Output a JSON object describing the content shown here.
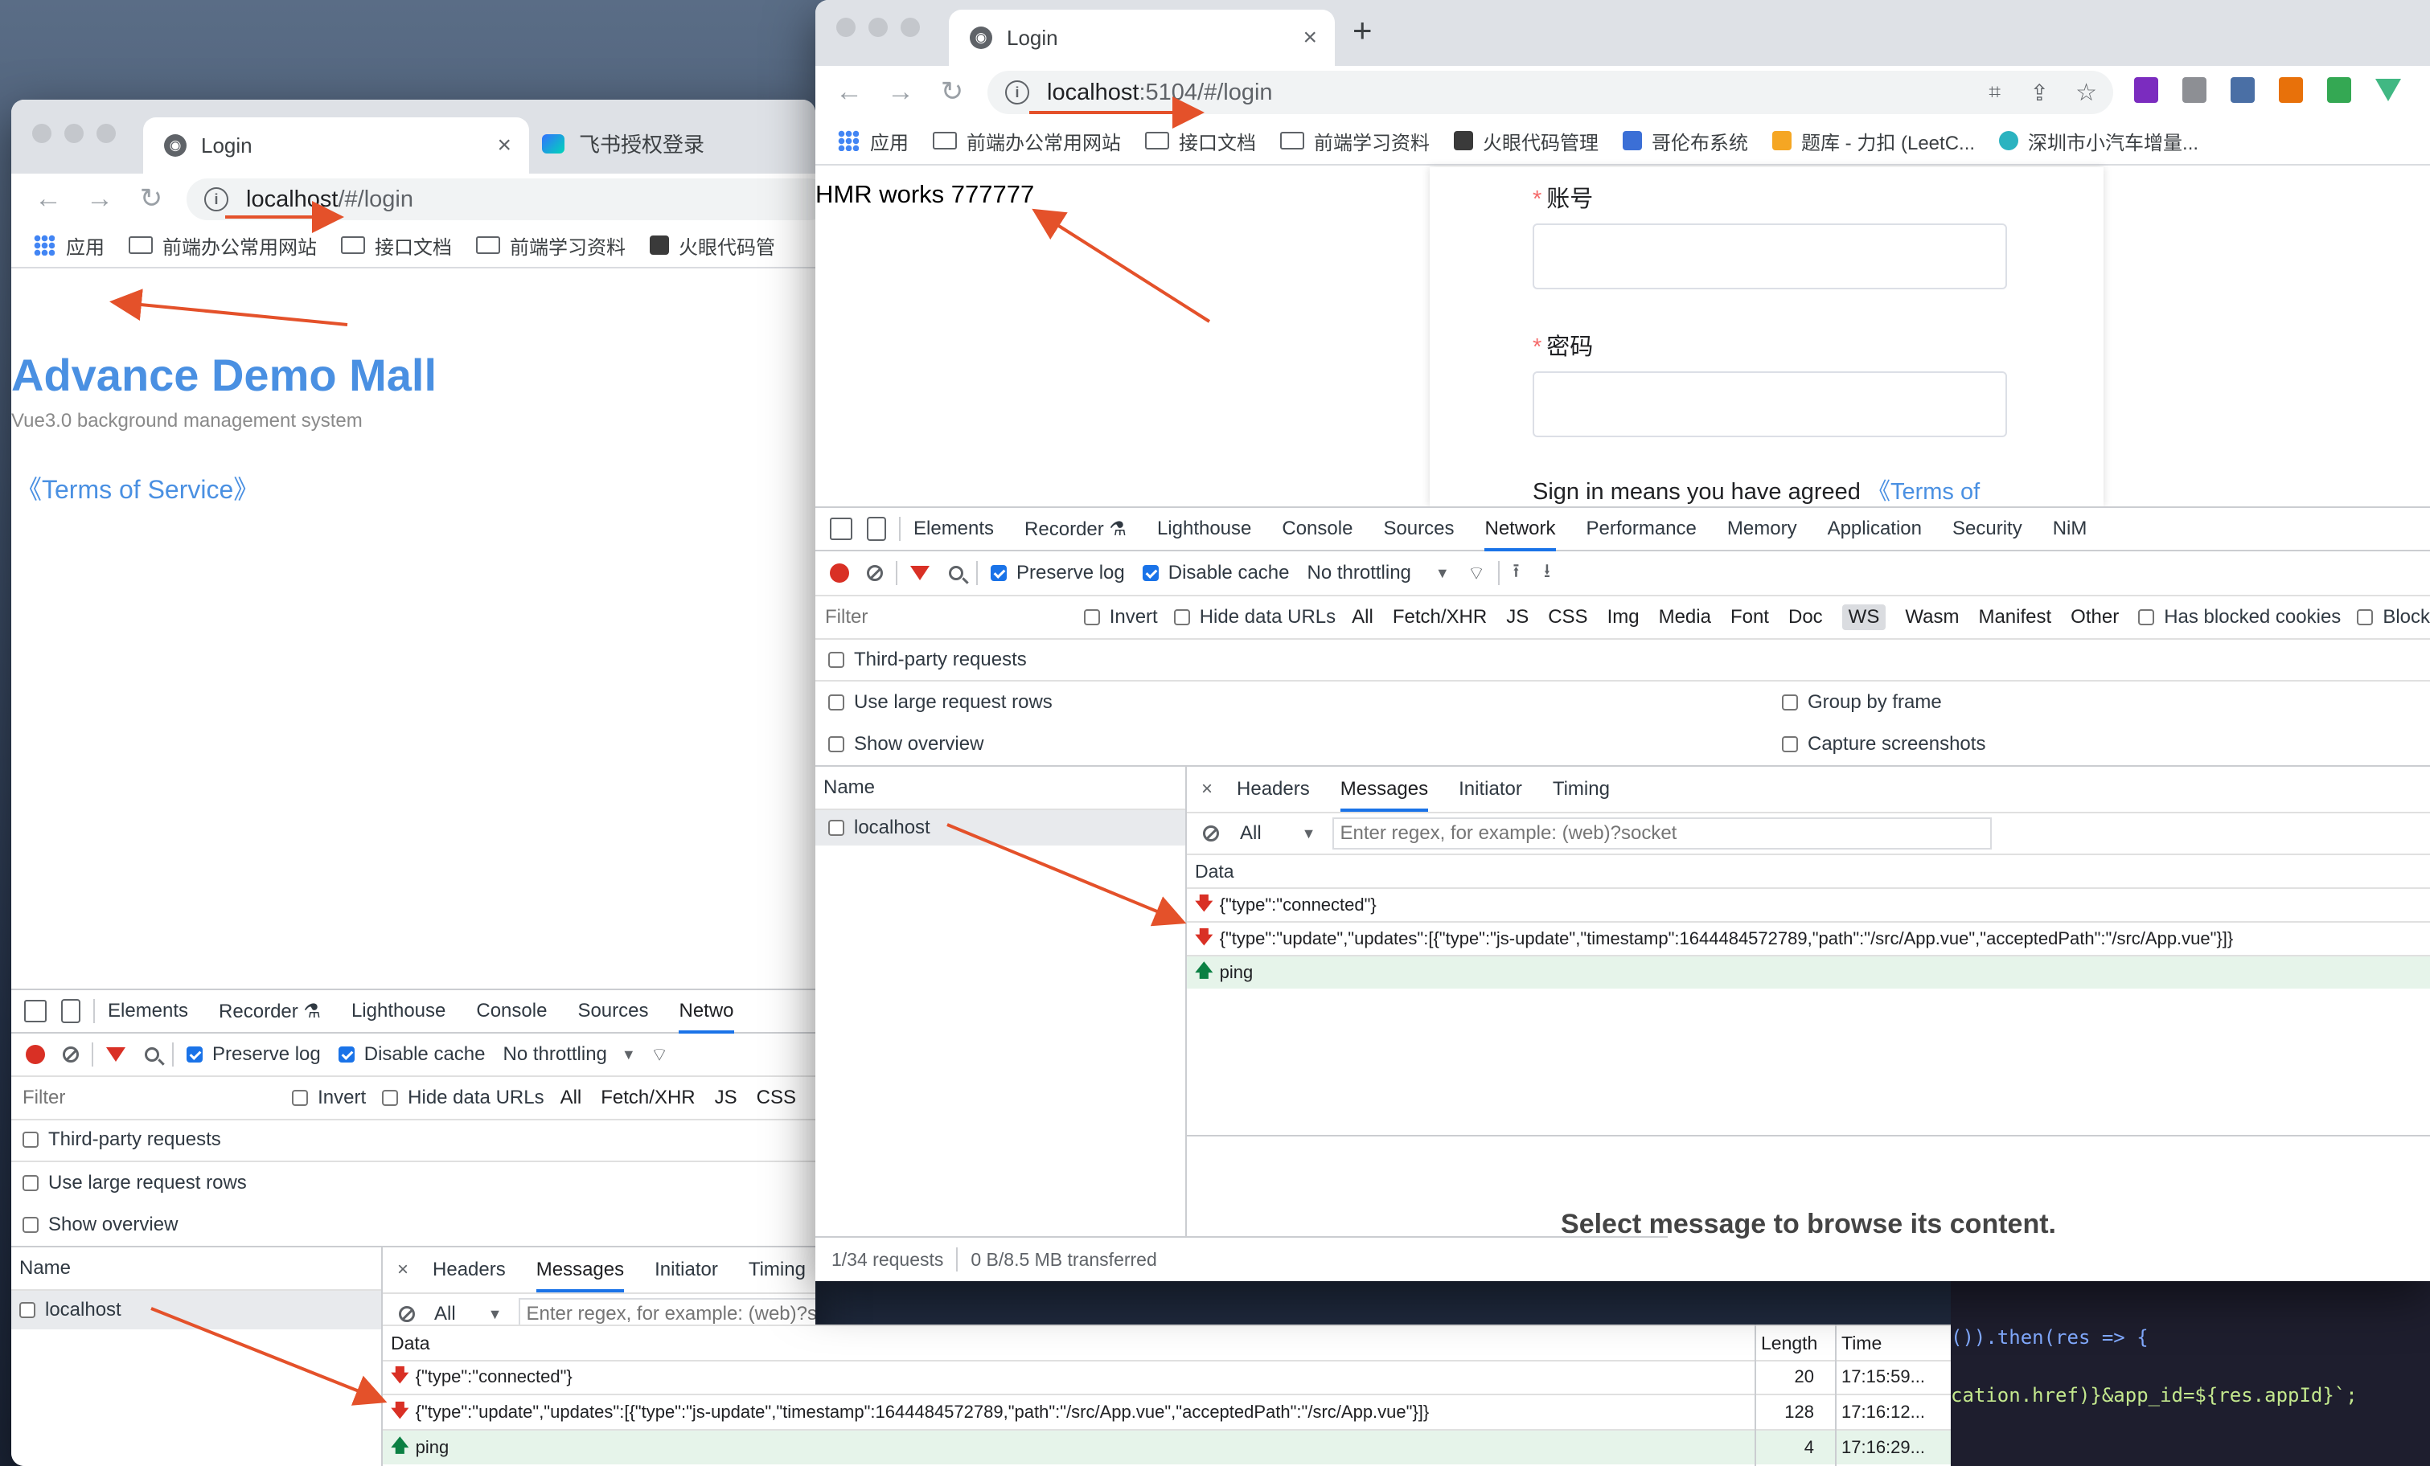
{
  "left_window": {
    "tabs": [
      {
        "title": "Login"
      },
      {
        "title": "飞书授权登录"
      }
    ],
    "url_host": "localhost",
    "url_rest": "/#/login",
    "bookmarks": [
      "应用",
      "前端办公常用网站",
      "接口文档",
      "前端学习资料",
      "火眼代码管"
    ],
    "page": {
      "title": "Advance Demo Mall",
      "subtitle": "Vue3.0 background management system",
      "terms": "《Terms of Service》"
    },
    "devtools": {
      "tabs": [
        "Elements",
        "Recorder ⚗",
        "Lighthouse",
        "Console",
        "Sources",
        "Netwo"
      ],
      "preserve_log": "Preserve log",
      "disable_cache": "Disable cache",
      "throttling": "No throttling",
      "filter_placeholder": "Filter",
      "invert": "Invert",
      "hide_data_urls": "Hide data URLs",
      "types": [
        "All",
        "Fetch/XHR",
        "JS",
        "CSS"
      ],
      "third_party": "Third-party requests",
      "large_rows": "Use large request rows",
      "overview": "Show overview",
      "name_header": "Name",
      "request_name": "localhost",
      "subtabs": [
        "Headers",
        "Messages",
        "Initiator",
        "Timing"
      ],
      "msg_filter_all": "All",
      "msg_filter_placeholder": "Enter regex, for example: (web)?socket",
      "cols": {
        "data": "Data",
        "length": "Length",
        "time": "Time"
      },
      "messages": [
        {
          "data": "{\"type\":\"connected\"}",
          "length": "20",
          "time": "17:15:59...",
          "dir": "down"
        },
        {
          "data": "{\"type\":\"update\",\"updates\":[{\"type\":\"js-update\",\"timestamp\":1644484572789,\"path\":\"/src/App.vue\",\"acceptedPath\":\"/src/App.vue\"}]}",
          "length": "128",
          "time": "17:16:12...",
          "dir": "down"
        },
        {
          "data": "ping",
          "length": "4",
          "time": "17:16:29...",
          "dir": "up"
        }
      ]
    }
  },
  "right_window": {
    "tab_title": "Login",
    "url_host": "localhost",
    "url_rest": ":5104/#/login",
    "bookmarks": [
      "应用",
      "前端办公常用网站",
      "接口文档",
      "前端学习资料",
      "火眼代码管理",
      "哥伦布系统",
      "题库 - 力扣 (LeetC...",
      "深圳市小汽车增量..."
    ],
    "page": {
      "hmr_text": "HMR works 777777",
      "account_label": "账号",
      "password_label": "密码",
      "required_mark": "*",
      "agree_text": "Sign in means you have agreed ",
      "agree_link": "《Terms of"
    },
    "devtools": {
      "tabs": [
        "Elements",
        "Recorder ⚗",
        "Lighthouse",
        "Console",
        "Sources",
        "Network",
        "Performance",
        "Memory",
        "Application",
        "Security",
        "NiM"
      ],
      "active_tab": "Network",
      "preserve_log": "Preserve log",
      "disable_cache": "Disable cache",
      "throttling": "No throttling",
      "filter_placeholder": "Filter",
      "invert": "Invert",
      "hide_data_urls": "Hide data URLs",
      "types": [
        "All",
        "Fetch/XHR",
        "JS",
        "CSS",
        "Img",
        "Media",
        "Font",
        "Doc",
        "WS",
        "Wasm",
        "Manifest",
        "Other"
      ],
      "selected_type": "WS",
      "has_blocked": "Has blocked cookies",
      "blocked": "Block",
      "third_party": "Third-party requests",
      "large_rows": "Use large request rows",
      "overview": "Show overview",
      "group_by_frame": "Group by frame",
      "capture": "Capture screenshots",
      "name_header": "Name",
      "request_name": "localhost",
      "subtabs": [
        "Headers",
        "Messages",
        "Initiator",
        "Timing"
      ],
      "msg_filter_all": "All",
      "msg_filter_placeholder": "Enter regex, for example: (web)?socket",
      "data_header": "Data",
      "messages": [
        {
          "data": "{\"type\":\"connected\"}",
          "dir": "down"
        },
        {
          "data": "{\"type\":\"update\",\"updates\":[{\"type\":\"js-update\",\"timestamp\":1644484572789,\"path\":\"/src/App.vue\",\"acceptedPath\":\"/src/App.vue\"}]}",
          "dir": "down"
        },
        {
          "data": "ping",
          "dir": "up"
        }
      ],
      "select_msg": "Select message to browse its content.",
      "status_requests": "1/34 requests",
      "status_transferred": "0 B/8.5 MB transferred"
    }
  },
  "code": {
    "line1": "()).then(res => {",
    "line2": "cation.href)}&app_id=${res.appId}`;"
  },
  "colors": {
    "accent": "#1a73e8",
    "annotation": "#e4512a",
    "link": "#4a90e2"
  }
}
